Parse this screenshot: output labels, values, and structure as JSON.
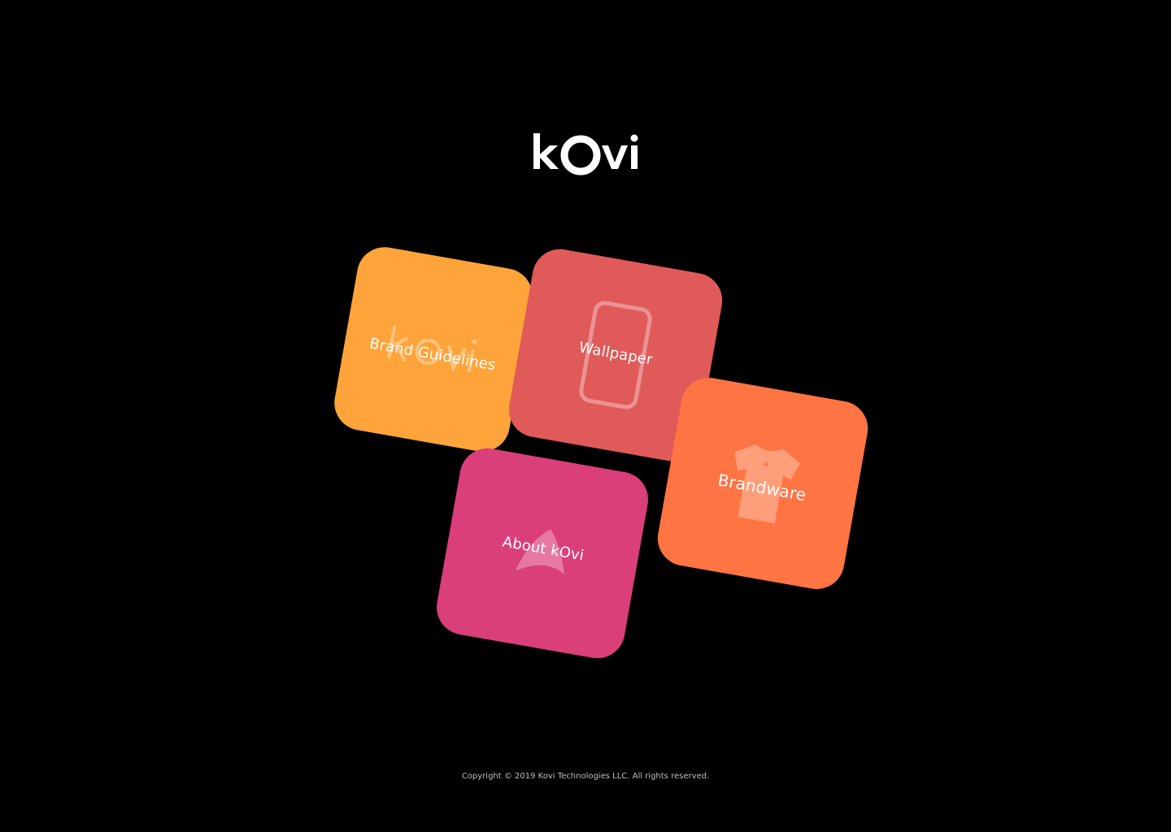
{
  "header": {
    "logo_text": "kOvi",
    "logo_icon": "kovi-logo-icon"
  },
  "cards": [
    {
      "label": "Brand Guidelines",
      "icon": "kovi-watermark-icon",
      "color": "#ffa43a"
    },
    {
      "label": "Wallpaper",
      "icon": "phone-outline-icon",
      "color": "#e05a59"
    },
    {
      "label": "Brandware",
      "icon": "tshirt-icon",
      "color": "#ff7443"
    },
    {
      "label": "About kOvi",
      "icon": "kovi-shape-icon",
      "color": "#da3f7a"
    }
  ],
  "footer": {
    "copyright": "Copyright © 2019 Kovi Technologies LLC. All rights reserved."
  },
  "colors": {
    "background": "#000000",
    "text": "#ffffff",
    "footer_text": "#bfbfbf"
  }
}
